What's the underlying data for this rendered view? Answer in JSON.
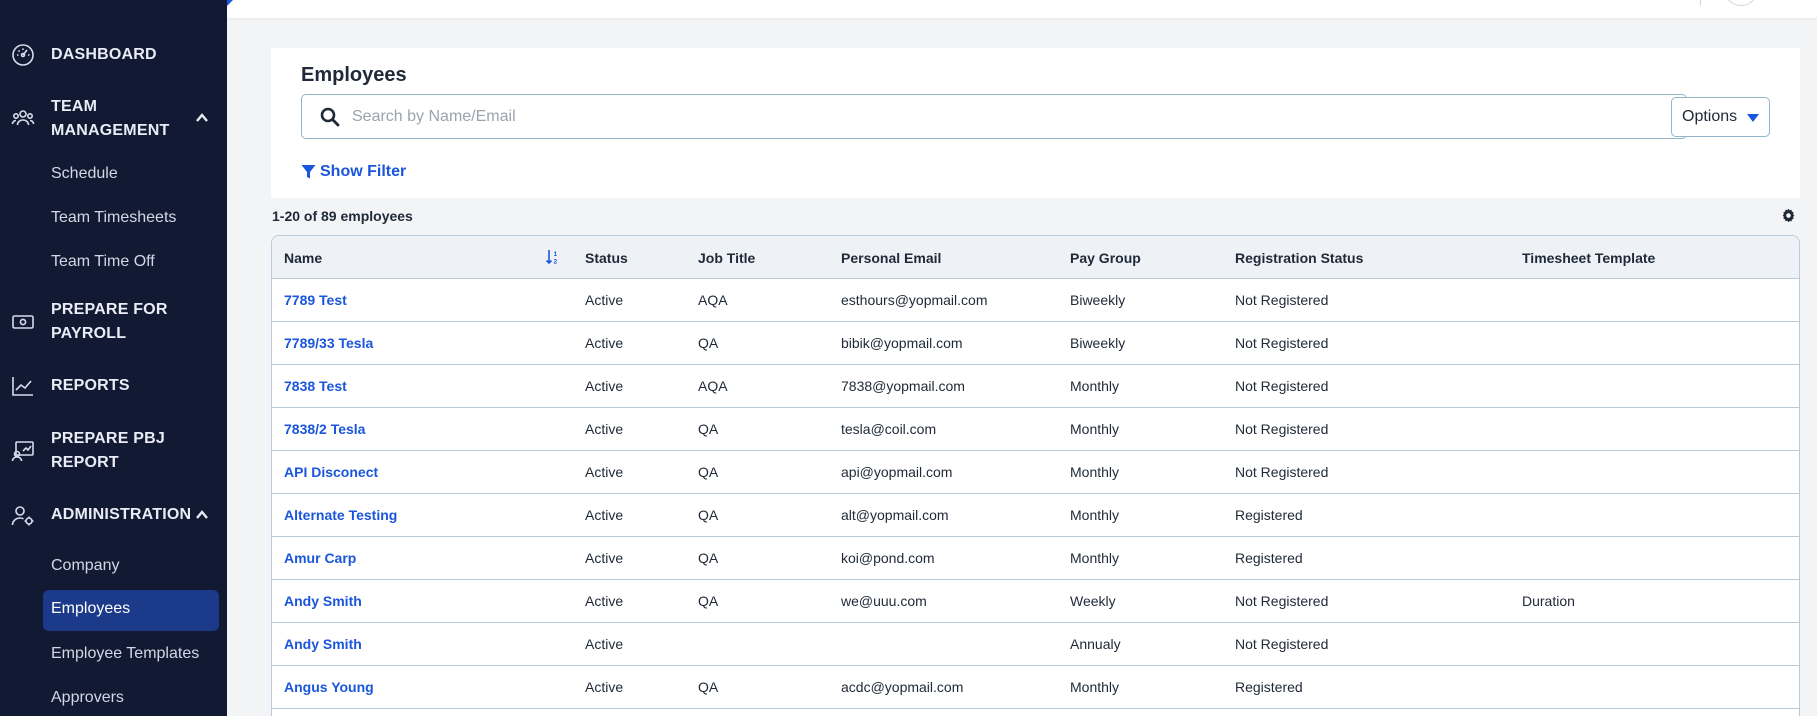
{
  "sidebar": {
    "items": [
      {
        "label": "DASHBOARD",
        "icon": "dashboard-icon"
      },
      {
        "label": "TEAM MANAGEMENT",
        "icon": "team-icon",
        "expanded": true,
        "children": [
          "Schedule",
          "Team Timesheets",
          "Team Time Off"
        ]
      },
      {
        "label": "PREPARE FOR PAYROLL",
        "icon": "payroll-icon"
      },
      {
        "label": "REPORTS",
        "icon": "reports-icon"
      },
      {
        "label": "PREPARE PBJ REPORT",
        "icon": "pbj-icon"
      },
      {
        "label": "ADMINISTRATION",
        "icon": "admin-icon",
        "expanded": true,
        "children": [
          "Company",
          "Employees",
          "Employee Templates",
          "Approvers"
        ]
      }
    ],
    "team_mgmt_line1": "TEAM",
    "team_mgmt_line2": "MANAGEMENT",
    "payroll_line1": "PREPARE FOR",
    "payroll_line2": "PAYROLL",
    "pbj_line1": "PREPARE PBJ",
    "pbj_line2": "REPORT",
    "active_child": "Employees"
  },
  "page": {
    "title": "Employees",
    "search_placeholder": "Search by Name/Email",
    "search_value": "",
    "options_label": "Options",
    "show_filter_label": "Show Filter",
    "count_text": "1-20 of 89 employees"
  },
  "table": {
    "columns": [
      "Name",
      "Status",
      "Job Title",
      "Personal Email",
      "Pay Group",
      "Registration Status",
      "Timesheet Template"
    ],
    "rows": [
      [
        "7789 Test",
        "Active",
        "AQA",
        "esthours@yopmail.com",
        "Biweekly",
        "Not Registered",
        ""
      ],
      [
        "7789/33 Tesla",
        "Active",
        "QA",
        "bibik@yopmail.com",
        "Biweekly",
        "Not Registered",
        ""
      ],
      [
        "7838 Test",
        "Active",
        "AQA",
        "7838@yopmail.com",
        "Monthly",
        "Not Registered",
        ""
      ],
      [
        "7838/2 Tesla",
        "Active",
        "QA",
        "tesla@coil.com",
        "Monthly",
        "Not Registered",
        ""
      ],
      [
        "API Disconect",
        "Active",
        "QA",
        "api@yopmail.com",
        "Monthly",
        "Not Registered",
        ""
      ],
      [
        "Alternate Testing",
        "Active",
        "QA",
        "alt@yopmail.com",
        "Monthly",
        "Registered",
        ""
      ],
      [
        "Amur Carp",
        "Active",
        "QA",
        "koi@pond.com",
        "Monthly",
        "Registered",
        ""
      ],
      [
        "Andy Smith",
        "Active",
        "QA",
        "we@uuu.com",
        "Weekly",
        "Not Registered",
        "Duration"
      ],
      [
        "Andy Smith",
        "Active",
        "",
        "",
        "Annualy",
        "Not Registered",
        ""
      ],
      [
        "Angus Young",
        "Active",
        "QA",
        "acdc@yopmail.com",
        "Monthly",
        "Registered",
        ""
      ]
    ]
  },
  "colors": {
    "sidebar_bg": "#121a33",
    "active_bg": "#1c3a8a",
    "accent": "#1a56db",
    "table_border": "#b9cad8"
  }
}
